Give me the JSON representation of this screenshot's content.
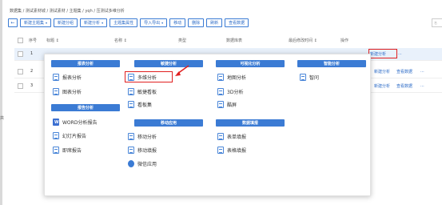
{
  "side_label": "共",
  "breadcrumb": "数据集 / 测试素材城 / 测试素材 / 主题集 / yqh / 压测试多维分析",
  "toolbar": {
    "back": "←",
    "buttons": [
      "新建主题集",
      "新建分组",
      "新建分析",
      "主题集属性",
      "导入导出",
      "移动",
      "删除",
      "刷新",
      "查看数据"
    ]
  },
  "search": {
    "placeholder": "名"
  },
  "table": {
    "headers": [
      "序号",
      "标题 ↕",
      "名称 ↕",
      "类型",
      "数据库表",
      "最后修改时间 ↕",
      "操作"
    ],
    "rows": [
      {
        "num": "1",
        "actions": [
          "新建分析",
          "..."
        ]
      },
      {
        "num": "2",
        "actions": [
          "新建分析",
          "查看数据",
          "..."
        ]
      },
      {
        "num": "3",
        "actions": [
          "新建分析",
          "查看数据",
          "..."
        ]
      }
    ]
  },
  "menu": {
    "categories": {
      "report": "报表分析",
      "agile": "敏捷分析",
      "visual": "可视化分析",
      "smart": "智能分析",
      "report_dist": "报告分析",
      "mobile": "移动应用",
      "fill": "数据填报"
    },
    "items": {
      "report_analysis": "报表分析",
      "chart_analysis": "图表分析",
      "multi_analysis": "多维分析",
      "agile_dashboard": "敏捷看板",
      "dashboard_set": "看板集",
      "map_analysis": "地图分析",
      "analysis_3d": "3D分析",
      "big_screen": "酷屏",
      "query": "智问",
      "word_report": "WORD分析报告",
      "ppt_report": "幻灯片报告",
      "instant_report": "即席报告",
      "mobile_analysis": "移动分析",
      "mobile_fill": "移动填报",
      "wechat_app": "微信应用",
      "form_fill": "表单填报",
      "table_fill": "表格填报"
    }
  },
  "colors": {
    "accent": "#3b7bd4",
    "highlight": "#e02020"
  }
}
